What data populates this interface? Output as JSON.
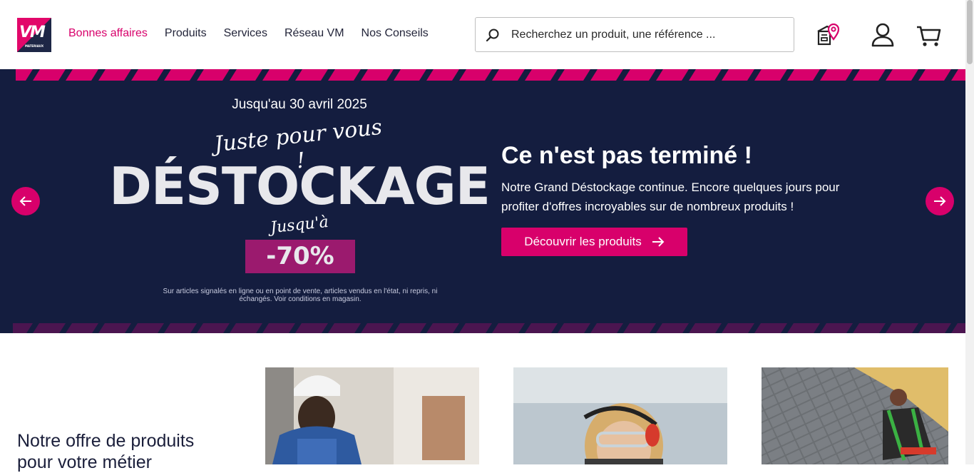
{
  "header": {
    "logo": {
      "text": "VM",
      "subtext": "MATERIAUX",
      "colors": {
        "dark": "#1d2646",
        "accent": "#e2076a"
      }
    },
    "nav": [
      {
        "label": "Bonnes affaires",
        "active": true
      },
      {
        "label": "Produits",
        "active": false
      },
      {
        "label": "Services",
        "active": false
      },
      {
        "label": "Réseau VM",
        "active": false
      },
      {
        "label": "Nos Conseils",
        "active": false
      }
    ],
    "search": {
      "placeholder": "Recherchez un produit, une référence ...",
      "icon": "search-icon"
    },
    "icons": [
      "store-locator-icon",
      "account-icon",
      "cart-icon"
    ]
  },
  "hero": {
    "date": "Jusqu'au 30 avril 2025",
    "script_top": "Juste pour vous !",
    "headline": "DÉSTOCKAGE",
    "script_bottom": "Jusqu'à",
    "discount": "-70%",
    "fine_print": "Sur articles signalés en ligne ou en point de vente, articles vendus en l'état, ni repris, ni échangés. Voir conditions en magasin.",
    "title": "Ce n'est pas terminé !",
    "description": "Notre Grand Déstockage continue. Encore quelques jours pour profiter d'offres incroyables sur de nombreux produits !",
    "cta": "Découvrir les produits",
    "colors": {
      "background": "#141d3f",
      "accent": "#d8006b"
    }
  },
  "offers": {
    "title": "Notre offre de produits pour votre métier"
  }
}
